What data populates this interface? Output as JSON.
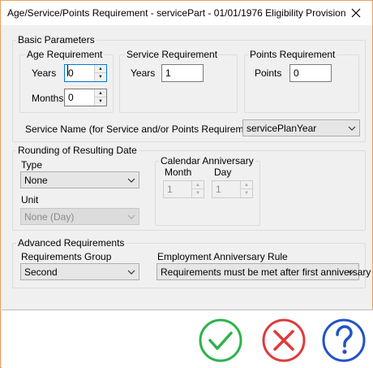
{
  "window": {
    "title": "Age/Service/Points Requirement - servicePart - 01/01/1976 Eligibility Provision",
    "border_color": "#e8a065"
  },
  "basic": {
    "legend": "Basic Parameters",
    "age": {
      "legend": "Age Requirement",
      "years_label": "Years",
      "years_value": "0",
      "months_label": "Months",
      "months_value": "0"
    },
    "service": {
      "legend": "Service Requirement",
      "years_label": "Years",
      "years_value": "1"
    },
    "points": {
      "legend": "Points Requirement",
      "points_label": "Points",
      "points_value": "0"
    },
    "service_name_label": "Service Name (for Service and/or Points Requirement)",
    "service_name_value": "servicePlanYear"
  },
  "rounding": {
    "legend": "Rounding of Resulting Date",
    "type_label": "Type",
    "type_value": "None",
    "unit_label": "Unit",
    "unit_value": "None (Day)",
    "calendar": {
      "legend": "Calendar Anniversary",
      "month_label": "Month",
      "month_value": "1",
      "day_label": "Day",
      "day_value": "1"
    }
  },
  "advanced": {
    "legend": "Advanced Requirements",
    "group_label": "Requirements Group",
    "group_value": "Second",
    "rule_label": "Employment Anniversary Rule",
    "rule_value": "Requirements must be met after first anniversary"
  },
  "icons": {
    "close": "close-icon",
    "spin_up": "spin-up-icon",
    "spin_down": "spin-down-icon",
    "dropdown": "chevron-down-icon",
    "ok": "checkmark-icon",
    "cancel": "cancel-x-icon",
    "help": "question-mark-icon"
  },
  "colors": {
    "ok": "#2db34a",
    "cancel": "#e03a3a",
    "help": "#1f53c7",
    "focus": "#0078d7"
  }
}
